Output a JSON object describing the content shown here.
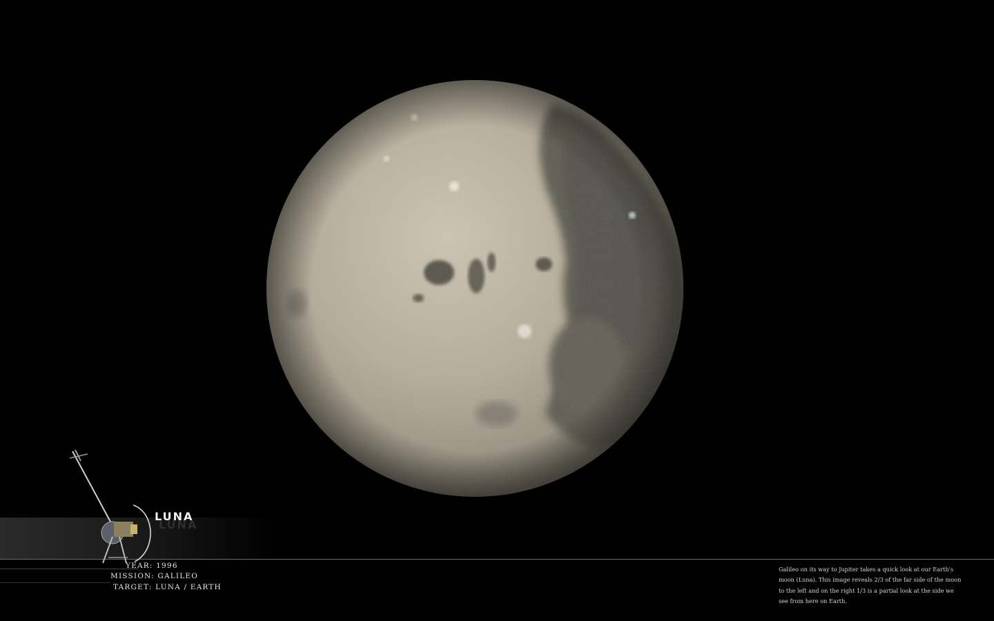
{
  "title": "LUNA",
  "meta": {
    "year_label": "YEAR:",
    "year_value": "1996",
    "mission_label": "MISSION:",
    "mission_value": "GALILEO",
    "target_label": "TARGET:",
    "target_value": "LUNA / EARTH"
  },
  "caption": "Galileo on its way to Jupiter takes a quick look at our Earth's moon (Luna). This image reveals 2/3 of the far side of the moon to the left and on the right 1/3 is a partial look at the side we see from here on Earth.",
  "colors": {
    "background": "#000000",
    "moon_light": "#b3aa97",
    "moon_mare": "#4d4b43",
    "text": "#e8e8e8"
  },
  "icons": {
    "spacecraft": "galileo-probe-icon"
  }
}
